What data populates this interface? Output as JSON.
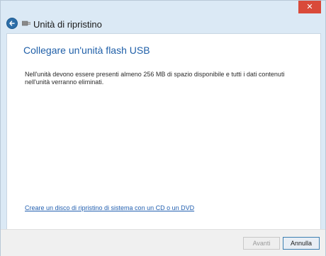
{
  "window": {
    "title": "Unità di ripristino",
    "close_glyph": "✕"
  },
  "icons": {
    "back": "back-arrow-icon",
    "drive": "usb-drive-icon",
    "close": "close-icon"
  },
  "page": {
    "title": "Collegare un'unità flash USB",
    "description": "Nell'unità devono essere presenti almeno 256 MB di spazio disponibile e tutti i dati contenuti nell'unità verranno eliminati.",
    "cd_link": "Creare un disco di ripristino di sistema con un CD o un DVD"
  },
  "footer": {
    "next_label": "Avanti",
    "cancel_label": "Annulla"
  },
  "colors": {
    "accent": "#1f5fa8",
    "close_red": "#d94a3a",
    "frame": "#dbe9f5"
  }
}
